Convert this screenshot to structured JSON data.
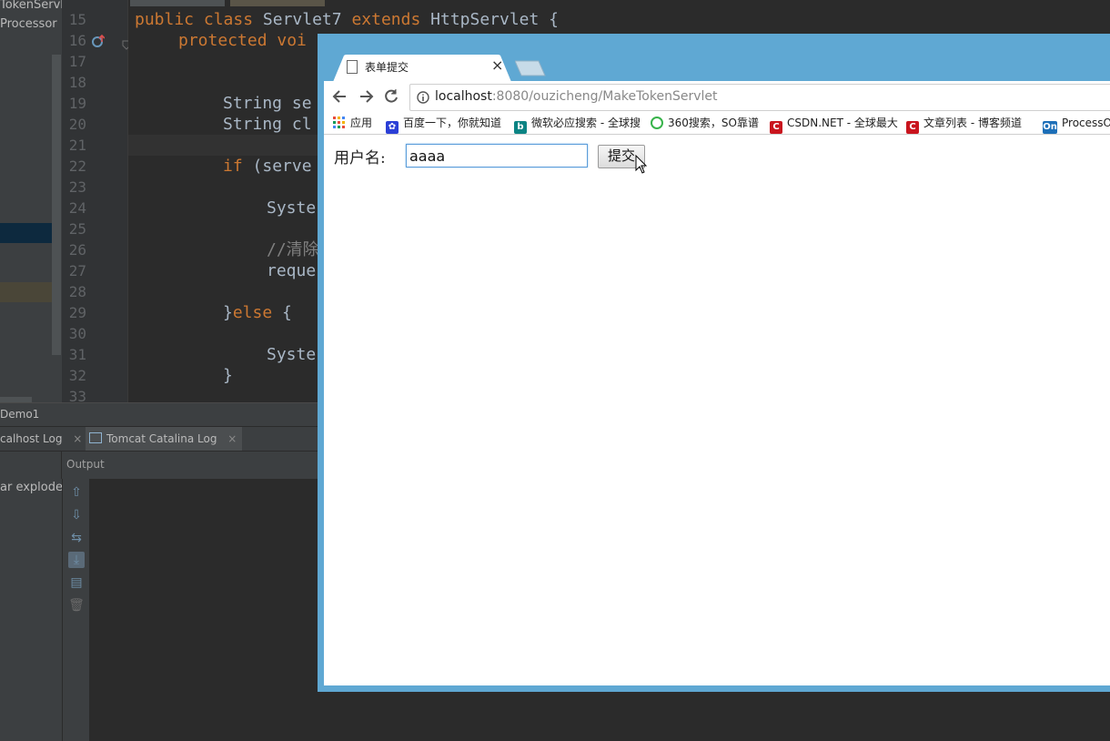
{
  "ide": {
    "project_items": [
      "TokenServlet",
      "Processor"
    ],
    "line_numbers": [
      "15",
      "16",
      "17",
      "18",
      "19",
      "20",
      "21",
      "22",
      "23",
      "24",
      "25",
      "26",
      "27",
      "28",
      "29",
      "30",
      "31",
      "32",
      "33"
    ],
    "code": {
      "l15_kw1": "public class ",
      "l15_name": "Servlet7 ",
      "l15_kw2": "extends ",
      "l15_rest": "HttpServlet {",
      "l16_kw": "protected voi",
      "l19": "String se",
      "l20": "String cl",
      "l22_kw": "if ",
      "l22_rest": "(serve",
      "l24": "Syste",
      "l26_cm": "//清除",
      "l27": "reque",
      "l29_a": "}",
      "l29_kw": "else ",
      "l29_b": "{",
      "l31": "Syste",
      "l32": "}"
    },
    "run_tab_label": "Demo1",
    "log_tabs": [
      "calhost Log",
      "Tomcat Catalina Log"
    ],
    "output_label": "Output",
    "artifact_label": "ar exploded"
  },
  "browser": {
    "tab_title": "表单提交",
    "url_host": "localhost",
    "url_rest": ":8080/ouzicheng/MakeTokenServlet",
    "bookmarks": [
      {
        "label": "应用",
        "icon": "apps-grid-icon",
        "color": "#e84c3d"
      },
      {
        "label": "百度一下，你就知道",
        "icon": "baidu-paw-icon",
        "color": "#2b3fd6"
      },
      {
        "label": "微软必应搜索 - 全球搜",
        "icon": "bing-icon",
        "color": "#0c8484"
      },
      {
        "label": "360搜索，SO靠谱",
        "icon": "360-icon",
        "color": "#37b34a"
      },
      {
        "label": "CSDN.NET - 全球最大",
        "icon": "csdn-icon",
        "color": "#c9151e"
      },
      {
        "label": "文章列表 - 博客频道",
        "icon": "csdn-icon",
        "color": "#c9151e"
      },
      {
        "label": "ProcessOn",
        "icon": "processon-icon",
        "color": "#1d6fb8"
      }
    ],
    "form": {
      "username_label": "用户名:",
      "username_value": "aaaa",
      "submit_label": "提交"
    }
  }
}
